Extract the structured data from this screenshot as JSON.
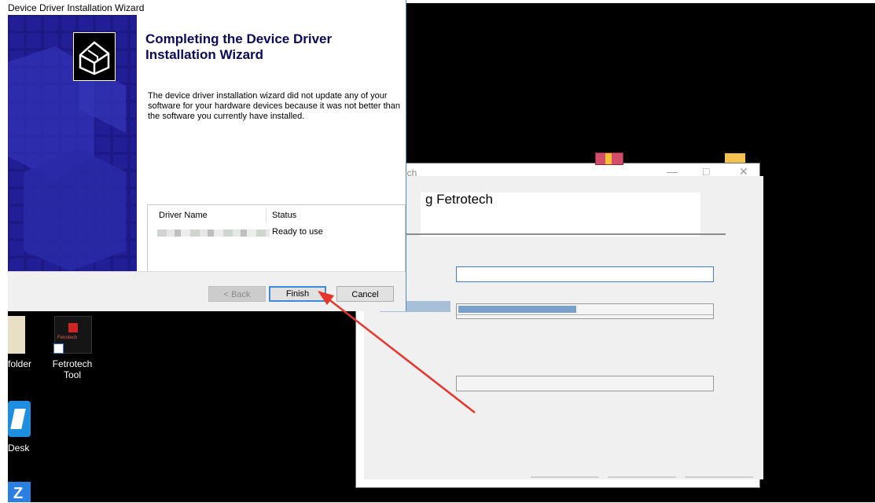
{
  "wizard": {
    "window_title": "Device Driver Installation Wizard",
    "heading": "Completing the Device Driver Installation Wizard",
    "description": "The device driver installation wizard did not update any of your software for your hardware devices because it was not better than the software you currently have installed.",
    "list": {
      "headers": [
        "Driver Name",
        "Status"
      ],
      "rows": [
        {
          "driver_name": "",
          "status": "Ready to use"
        }
      ]
    },
    "buttons": {
      "back": "< Back",
      "finish": "Finish",
      "cancel": "Cancel"
    }
  },
  "installer": {
    "title_fragment": "ech",
    "heading": "g Fetrotech",
    "progress": 0.47,
    "controls": {
      "minimize": "—",
      "maximize": "□",
      "close": "✕"
    }
  },
  "desktop": {
    "icons": [
      {
        "label": "folder"
      },
      {
        "label": "Fetrotech Tool",
        "icon_text": "Fetrotech"
      },
      {
        "label": "Desk"
      },
      {
        "label": "Z"
      }
    ]
  },
  "colors": {
    "accent": "#3c8ad8",
    "wizard_side": "#1e1b8c",
    "arrow": "#e8352c"
  }
}
